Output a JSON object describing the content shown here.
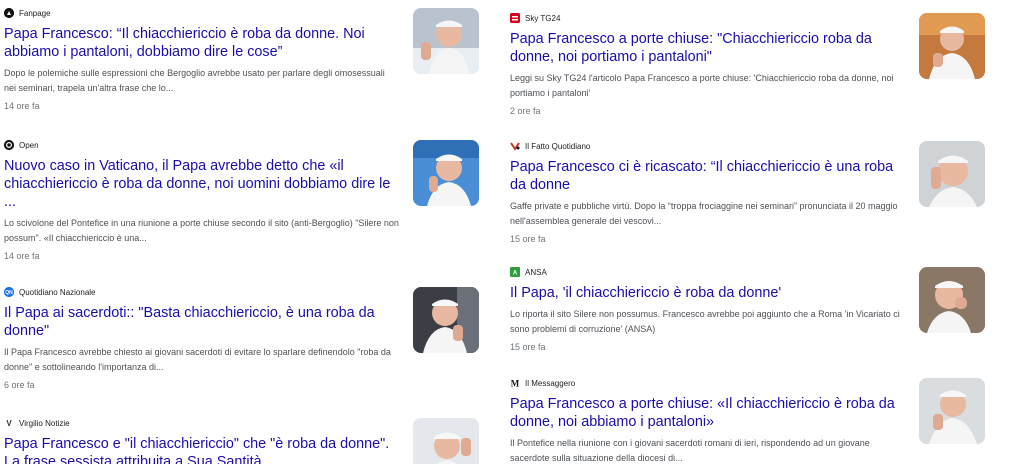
{
  "results_left": [
    {
      "source": "Fanpage",
      "title": "Papa Francesco: “Il chiacchiericcio è roba da donne. Noi abbiamo i pantaloni, dobbiamo dire le cose”",
      "snippet": "Dopo le polemiche sulle espressioni che Bergoglio avrebbe usato per parlare degli omosessuali nei seminari, trapela un'altra frase che lo...",
      "age": "14 ore fa",
      "favicon_icon": "fanpage-logo-icon",
      "favicon_color": "#111111"
    },
    {
      "source": "Open",
      "title": "Nuovo caso in Vaticano, il Papa avrebbe detto che «il chiacchiericcio è roba da donne, noi uomini dobbiamo dire le ...",
      "snippet": "Lo scivolone del Pontefice in una riunione a porte chiuse secondo il sito (anti-Bergoglio) \"Silere non possum\". «Il chiacchiericcio è una...",
      "age": "14 ore fa",
      "favicon_icon": "open-logo-icon",
      "favicon_color": "#111111"
    },
    {
      "source": "Quotidiano Nazionale",
      "title": "Il Papa ai sacerdoti:: \"Basta chiacchiericcio, è una roba da donne\"",
      "snippet": "Il Papa Francesco avrebbe chiesto ai giovani sacerdoti di evitare lo sparlare definendolo \"roba da donne\" e sottolineando l'importanza di...",
      "age": "6 ore fa",
      "favicon_icon": "qn-logo-icon",
      "favicon_color": "#1a73e8"
    },
    {
      "source": "Virgilio Notizie",
      "title": "Papa Francesco e \"il chiacchiericcio\" che \"è roba da donne\". La frase sessista attribuita a Sua Santità",
      "snippet": "",
      "age": "",
      "favicon_icon": "virgilio-logo-icon",
      "favicon_color": "#333333"
    }
  ],
  "results_right": [
    {
      "source": "Sky TG24",
      "title": "Papa Francesco a porte chiuse: \"Chiacchiericcio roba da donne, noi portiamo i pantaloni\"",
      "snippet": "Leggi su Sky TG24 l'articolo Papa Francesco a porte chiuse: 'Chiacchiericcio roba da donne, noi portiamo i pantaloni'",
      "age": "2 ore fa",
      "favicon_icon": "skytg24-logo-icon",
      "favicon_color": "#d6001c"
    },
    {
      "source": "Il Fatto Quotidiano",
      "title": "Papa Francesco ci è ricascato: “Il chiacchiericcio è una roba da donne",
      "snippet": "Gaffe private e pubbliche virtù. Dopo la “troppa frociaggine nei seminari” pronunciata il 20 maggio nell'assemblea generale dei vescovi...",
      "age": "15 ore fa",
      "favicon_icon": "ilfatto-logo-icon",
      "favicon_color": "#c0392b"
    },
    {
      "source": "ANSA",
      "title": "Il Papa, 'il chiacchiericcio è roba da donne'",
      "snippet": "Lo riporta il sito Silere non possumus. Francesco avrebbe poi aggiunto che a Roma 'in Vicariato ci sono problemi di corruzione' (ANSA)",
      "age": "15 ore fa",
      "favicon_icon": "ansa-logo-icon",
      "favicon_color": "#2e9e3e"
    },
    {
      "source": "Il Messaggero",
      "title": "Papa Francesco a porte chiuse: «Il chiacchiericcio è roba da donne, noi abbiamo i pantaloni»",
      "snippet": "Il Pontefice nella riunione con i giovani sacerdoti romani di ieri, rispondendo ad un giovane sacerdote sulla situazione della diocesi di...",
      "age": "",
      "favicon_icon": "messaggero-logo-icon",
      "favicon_color": "#111111"
    }
  ]
}
